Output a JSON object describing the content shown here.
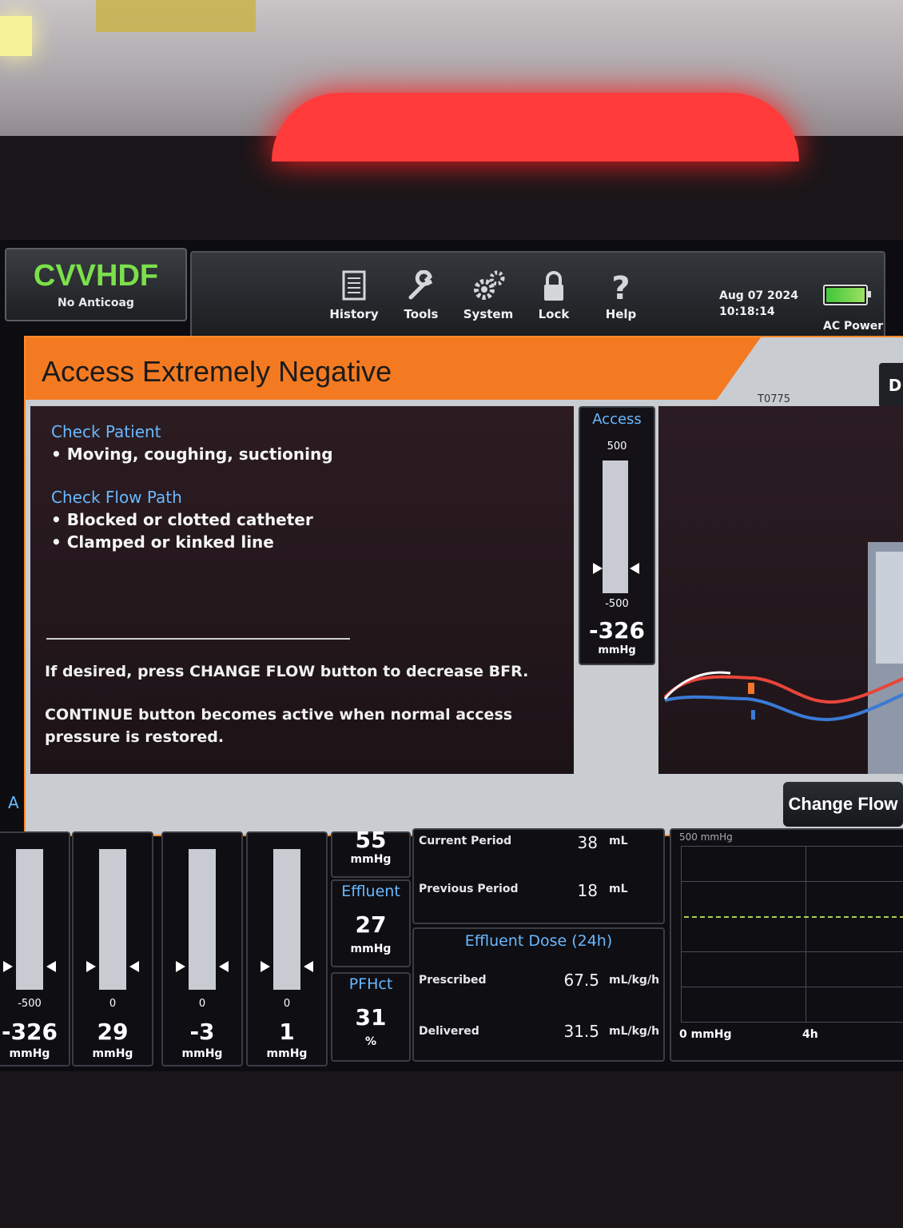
{
  "mode": {
    "title": "CVVHDF",
    "subtitle": "No Anticoag"
  },
  "toolbar": {
    "items": [
      {
        "label": "History",
        "icon": "history-icon"
      },
      {
        "label": "Tools",
        "icon": "wrench-icon"
      },
      {
        "label": "System",
        "icon": "gears-icon"
      },
      {
        "label": "Lock",
        "icon": "lock-icon"
      },
      {
        "label": "Help",
        "icon": "help-icon"
      }
    ],
    "date": "Aug 07 2024",
    "time": "10:18:14",
    "power": "AC Power",
    "battery_level": 1.0
  },
  "alarm": {
    "title": "Access Extremely Negative",
    "code": "T0775",
    "dismiss_label": "D",
    "sections": [
      {
        "heading": "Check Patient",
        "items": [
          "Moving, coughing, suctioning"
        ]
      },
      {
        "heading": "Check Flow Path",
        "items": [
          "Blocked or clotted catheter",
          "Clamped or kinked line"
        ]
      }
    ],
    "note1": "If desired, press CHANGE FLOW button to decrease BFR.",
    "note2": "CONTINUE button becomes active when normal access pressure is restored.",
    "change_flow_label": "Change Flow",
    "colors": {
      "header": "#f47a21",
      "heading_text": "#69b9ff"
    }
  },
  "access_gauge": {
    "title": "Access",
    "max": "500",
    "min": "-500",
    "value": "-326",
    "unit": "mmHg"
  },
  "bottom": {
    "section_letter": "A",
    "pressures": [
      {
        "min": "-500",
        "value": "-326",
        "unit": "mmHg"
      },
      {
        "min": "0",
        "value": "29",
        "unit": "mmHg"
      },
      {
        "min": "0",
        "value": "-3",
        "unit": "mmHg"
      },
      {
        "min": "0",
        "value": "1",
        "unit": "mmHg"
      }
    ],
    "mid": [
      {
        "title": "",
        "value": "55",
        "unit": "mmHg"
      },
      {
        "title": "Effluent",
        "value": "27",
        "unit": "mmHg"
      },
      {
        "title": "PFHct",
        "value": "31",
        "unit": "%"
      }
    ],
    "volume": {
      "current_label": "Current Period",
      "current_value": "38",
      "current_unit": "mL",
      "previous_label": "Previous Period",
      "previous_value": "18",
      "previous_unit": "mL"
    },
    "dose": {
      "title": "Effluent Dose (24h)",
      "prescribed_label": "Prescribed",
      "prescribed_value": "67.5",
      "prescribed_unit": "mL/kg/h",
      "delivered_label": "Delivered",
      "delivered_value": "31.5",
      "delivered_unit": "mL/kg/h"
    },
    "trend": {
      "top_label": "500 mmHg",
      "bottom_label": "0 mmHg",
      "time_label": "4h"
    }
  }
}
